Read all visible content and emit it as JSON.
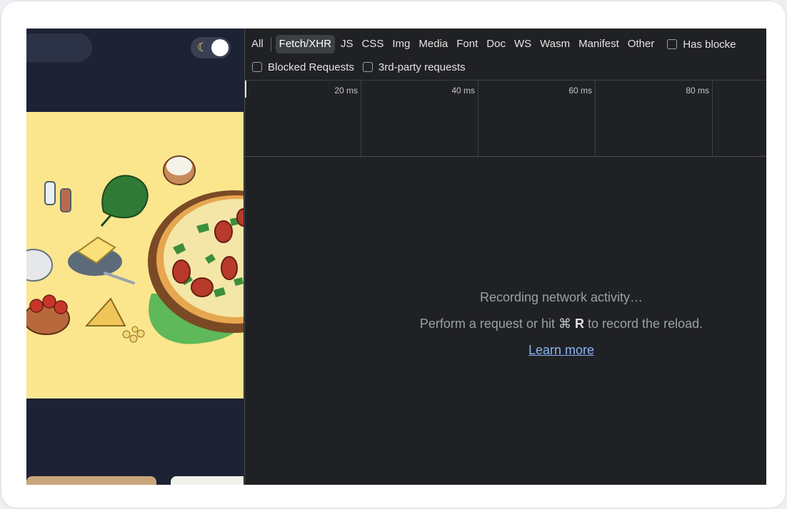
{
  "site": {
    "theme_toggle_icon": "moon-icon"
  },
  "devtools": {
    "filter_types": [
      "All",
      "Fetch/XHR",
      "JS",
      "CSS",
      "Img",
      "Media",
      "Font",
      "Doc",
      "WS",
      "Wasm",
      "Manifest",
      "Other"
    ],
    "active_filter": "Fetch/XHR",
    "has_blocked_label": "Has blocke",
    "blocked_requests_label": "Blocked Requests",
    "third_party_label": "3rd-party requests",
    "timeline_ticks": [
      "20 ms",
      "40 ms",
      "60 ms",
      "80 ms"
    ],
    "empty_title": "Recording network activity…",
    "empty_hint_before": "Perform a request or hit",
    "empty_hint_key_symbol": "⌘",
    "empty_hint_key": "R",
    "empty_hint_after": "to record the reload.",
    "learn_more": "Learn more"
  },
  "colors": {
    "devtools_bg": "#202124",
    "site_bg": "#1d2234",
    "hero_bg": "#fbe68e",
    "link": "#8ab4f8"
  }
}
